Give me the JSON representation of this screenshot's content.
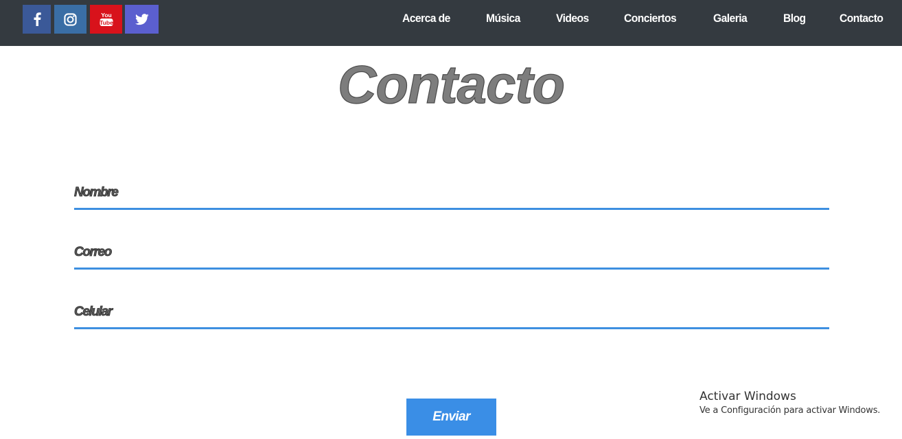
{
  "navbar": {
    "social": [
      {
        "name": "facebook-icon",
        "color": "#3b5998"
      },
      {
        "name": "instagram-icon",
        "color": "#3a6ea5"
      },
      {
        "name": "youtube-icon",
        "color": "#d8121b",
        "text_top": "You",
        "text_bottom": "Tube"
      },
      {
        "name": "twitter-icon",
        "color": "#5b5fcf"
      }
    ],
    "items": [
      {
        "label": "Acerca de"
      },
      {
        "label": "Música"
      },
      {
        "label": "Videos"
      },
      {
        "label": "Conciertos"
      },
      {
        "label": "Galeria"
      },
      {
        "label": "Blog"
      },
      {
        "label": "Contacto"
      }
    ]
  },
  "page": {
    "title": "Contacto"
  },
  "form": {
    "fields": [
      {
        "label": "Nombre"
      },
      {
        "label": "Correo"
      },
      {
        "label": "Celular"
      }
    ],
    "submit_label": "Enviar"
  },
  "watermark": {
    "title": "Activar Windows",
    "subtitle": "Ve a Configuración para activar Windows."
  },
  "colors": {
    "navbar_bg": "#343a40",
    "accent": "#3d8fe0",
    "title_gray": "#7d7d7d"
  }
}
